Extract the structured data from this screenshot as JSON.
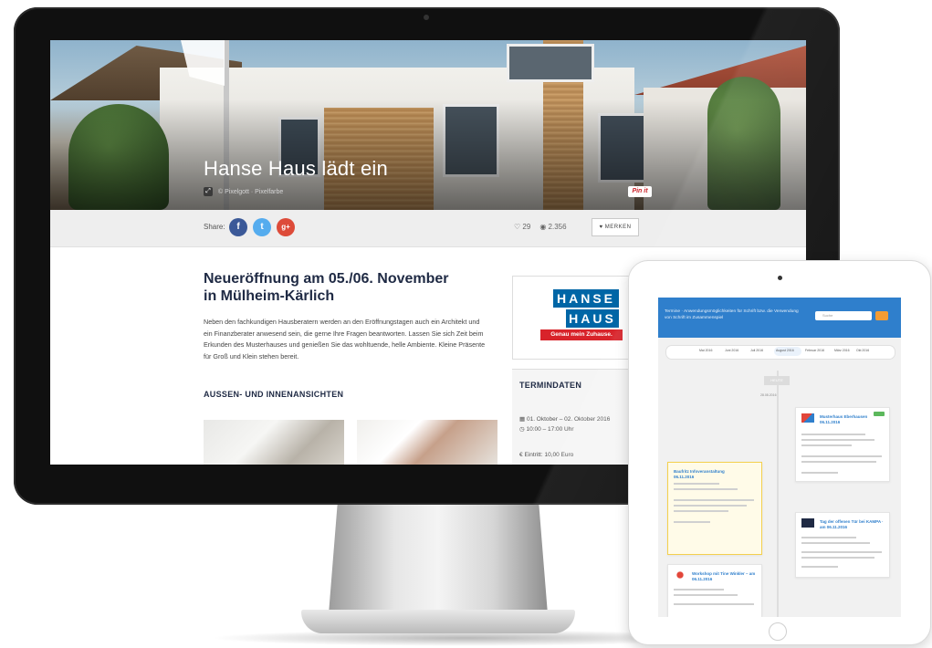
{
  "page": {
    "title": "Hanse Haus lädt ein",
    "photo_credit": "© Pixelgott · Pixelfarbe",
    "pinit_label": "Pin it"
  },
  "share": {
    "label": "Share:",
    "facebook": "f",
    "twitter": "t",
    "google": "g+",
    "likes": "29",
    "views": "2.356",
    "merken_label": "MERKEN"
  },
  "article": {
    "heading_line1": "Neueröffnung am 05./06. November",
    "heading_line2": "in Mülheim-Kärlich",
    "body": "Neben den fachkundigen Hausberatern werden an den Eröffnungstagen auch ein Architekt und ein Finanzberater anwesend sein, die gerne Ihre Fragen beantworten. Lassen Sie sich Zeit beim Erkunden des Musterhauses und genießen Sie das wohltuende, helle Ambiente. Kleine Präsente für Groß und Klein stehen bereit.",
    "section_heading": "AUSSEN- UND INNENANSICHTEN"
  },
  "sidebar": {
    "logo_line1": "HANSE",
    "logo_line2": "HAUS",
    "logo_tagline": "Genau mein Zuhause.",
    "termin_heading": "TERMINDATEN",
    "termin_date": "01. Oktober – 02. Oktober 2016",
    "termin_time": "10:00 – 17:00 Uhr",
    "termin_price": "Eintritt: 10,00 Euro"
  },
  "tablet": {
    "header_text": "Termine · Anwendungsmöglichkeiten für Schrift bzw. die Verwendung von Schrift im Zusammenspiel",
    "search_placeholder": "Suche",
    "timeline_months": [
      "Mai 2016",
      "Juni 2016",
      "Juli 2016",
      "August 2016",
      "Februar 2016",
      "März 2016",
      "Okt 2016"
    ],
    "today_label": "HEUTE",
    "today_date": "28.08.2016",
    "events": [
      {
        "title": "Musterhaus Eberhausen 06.11.2016"
      },
      {
        "title": "Baufritz Infoveranstaltung 06.11.2016"
      },
      {
        "title": "Tag der offenen Tür bei KAMPA · am 06.11.2016"
      },
      {
        "title": "Workshop mit Tine Winkler – am 06.11.2016"
      }
    ]
  },
  "colors": {
    "accent_blue": "#2f7fcc",
    "hanse_blue": "#0066a6",
    "hanse_red": "#d8232a",
    "facebook": "#3b5998",
    "twitter": "#55acee",
    "google": "#dd4b39"
  }
}
